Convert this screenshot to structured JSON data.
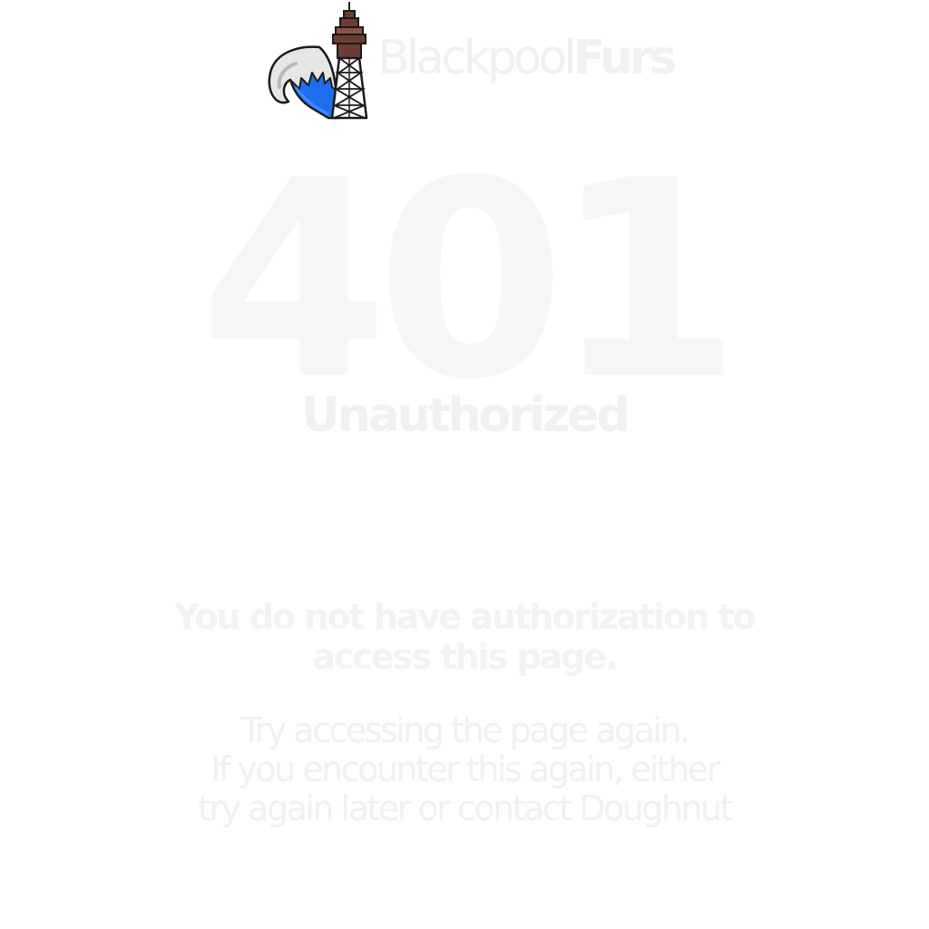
{
  "brand": {
    "name_light": "Blackpool",
    "name_bold": "Furs",
    "logo_icon": "fox-tail-tower-logo",
    "colors": {
      "tail_blue": "#1e6ff0",
      "tail_white": "#e6e6e6",
      "tower_brown": "#6b3d33",
      "outline": "#1a1a1a"
    }
  },
  "error": {
    "code": "401",
    "title": "Unauthorized",
    "message_lines": [
      "You do not have authorization to",
      "access this page."
    ],
    "hint_lines": [
      "Try accessing the page again.",
      "If you encounter this again, either",
      "try again later or contact Doughnut"
    ]
  }
}
